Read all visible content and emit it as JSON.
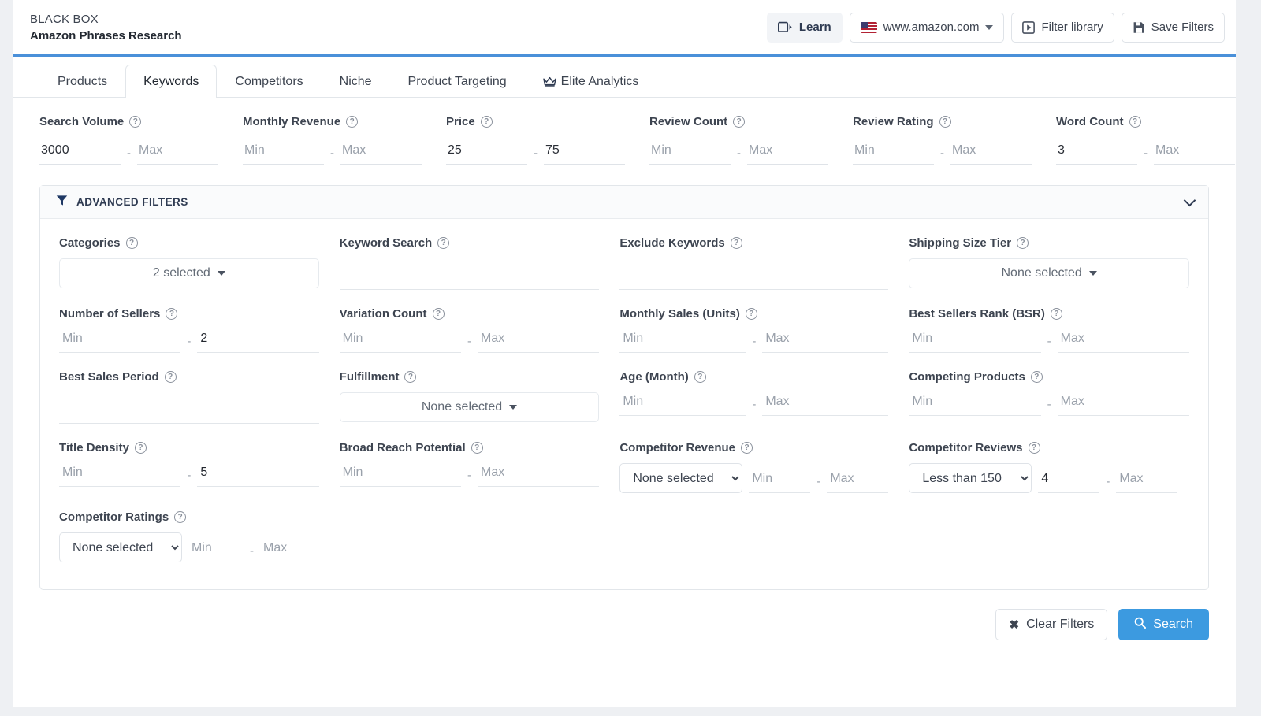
{
  "header": {
    "eyebrow": "BLACK BOX",
    "title": "Amazon Phrases Research",
    "learn_label": "Learn",
    "marketplace": "www.amazon.com",
    "filter_library_label": "Filter library",
    "save_filters_label": "Save Filters",
    "accent_color": "#4a90d9"
  },
  "tabs": [
    {
      "label": "Products",
      "active": false
    },
    {
      "label": "Keywords",
      "active": true
    },
    {
      "label": "Competitors",
      "active": false
    },
    {
      "label": "Niche",
      "active": false
    },
    {
      "label": "Product Targeting",
      "active": false
    },
    {
      "label": "Elite Analytics",
      "active": false,
      "icon": "crown-icon"
    }
  ],
  "primary_filters": [
    {
      "label": "Search Volume",
      "min_value": "3000",
      "min_placeholder": "Min",
      "max_value": "",
      "max_placeholder": "Max"
    },
    {
      "label": "Monthly Revenue",
      "min_value": "",
      "min_placeholder": "Min",
      "max_value": "",
      "max_placeholder": "Max"
    },
    {
      "label": "Price",
      "min_value": "25",
      "min_placeholder": "Min",
      "max_value": "75",
      "max_placeholder": "Max"
    },
    {
      "label": "Review Count",
      "min_value": "",
      "min_placeholder": "Min",
      "max_value": "",
      "max_placeholder": "Max"
    },
    {
      "label": "Review Rating",
      "min_value": "",
      "min_placeholder": "Min",
      "max_value": "",
      "max_placeholder": "Max"
    },
    {
      "label": "Word Count",
      "min_value": "3",
      "min_placeholder": "Min",
      "max_value": "",
      "max_placeholder": "Max"
    }
  ],
  "advanced": {
    "title": "ADVANCED FILTERS",
    "expanded": true,
    "cells": {
      "categories": {
        "label": "Categories",
        "type": "multiselect",
        "value": "2 selected"
      },
      "keyword_search": {
        "label": "Keyword Search",
        "type": "text",
        "value": "",
        "placeholder": ""
      },
      "exclude_keywords": {
        "label": "Exclude Keywords",
        "type": "text",
        "value": "",
        "placeholder": ""
      },
      "shipping_size": {
        "label": "Shipping Size Tier",
        "type": "multiselect",
        "value": "None selected"
      },
      "number_of_sellers": {
        "label": "Number of Sellers",
        "type": "range",
        "min_value": "",
        "min_placeholder": "Min",
        "max_value": "2",
        "max_placeholder": "Max"
      },
      "variation_count": {
        "label": "Variation Count",
        "type": "range",
        "min_value": "",
        "min_placeholder": "Min",
        "max_value": "",
        "max_placeholder": "Max"
      },
      "monthly_sales": {
        "label": "Monthly Sales (Units)",
        "type": "range",
        "min_value": "",
        "min_placeholder": "Min",
        "max_value": "",
        "max_placeholder": "Max"
      },
      "bsr": {
        "label": "Best Sellers Rank (BSR)",
        "type": "range",
        "min_value": "",
        "min_placeholder": "Min",
        "max_value": "",
        "max_placeholder": "Max"
      },
      "best_sales_period": {
        "label": "Best Sales Period",
        "type": "text",
        "value": "",
        "placeholder": ""
      },
      "fulfillment": {
        "label": "Fulfillment",
        "type": "multiselect",
        "value": "None selected"
      },
      "age_month": {
        "label": "Age (Month)",
        "type": "range",
        "min_value": "",
        "min_placeholder": "Min",
        "max_value": "",
        "max_placeholder": "Max"
      },
      "competing_products": {
        "label": "Competing Products",
        "type": "range",
        "min_value": "",
        "min_placeholder": "Min",
        "max_value": "",
        "max_placeholder": "Max"
      },
      "title_density": {
        "label": "Title Density",
        "type": "range",
        "min_value": "",
        "min_placeholder": "Min",
        "max_value": "5",
        "max_placeholder": "Max"
      },
      "broad_reach": {
        "label": "Broad Reach Potential",
        "type": "range",
        "min_value": "",
        "min_placeholder": "Min",
        "max_value": "",
        "max_placeholder": "Max"
      },
      "competitor_revenue": {
        "label": "Competitor Revenue",
        "type": "select-range",
        "select_value": "None selected",
        "min_value": "",
        "min_placeholder": "Min",
        "max_value": "",
        "max_placeholder": "Max"
      },
      "competitor_reviews": {
        "label": "Competitor Reviews",
        "type": "select-range",
        "select_value": "Less than 150",
        "min_value": "4",
        "min_placeholder": "Min",
        "max_value": "",
        "max_placeholder": "Max"
      },
      "competitor_ratings": {
        "label": "Competitor Ratings",
        "type": "select-range",
        "select_value": "None selected",
        "min_value": "",
        "min_placeholder": "Min",
        "max_value": "",
        "max_placeholder": "Max"
      }
    },
    "select_options": {
      "competitor_revenue": [
        "None selected"
      ],
      "competitor_reviews": [
        "Less than 150"
      ],
      "competitor_ratings": [
        "None selected"
      ]
    }
  },
  "footer": {
    "clear_label": "Clear Filters",
    "search_label": "Search",
    "search_color": "#3c9ae0"
  },
  "glyphs": {
    "help": "?",
    "dash": "-",
    "x": "✖"
  }
}
